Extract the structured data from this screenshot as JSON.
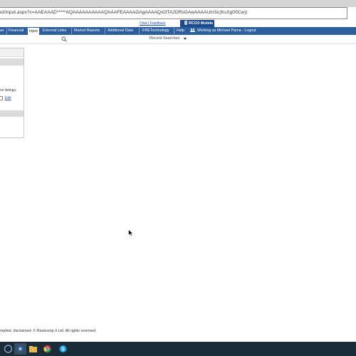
{
  "browser": {
    "address": {
      "visible_text": "ut/Input.aspx?c=AAEAAAD*****AQAAAAAAAAAAQAAAFEAAAAGAgAAAAQxOTA2DRsGAwAAAAUmSc(KsXg00Cw))"
    }
  },
  "header": {
    "chat_link": "Chat | Feedback",
    "mobile_label": "RCO3 Mobile"
  },
  "nav": {
    "items": [
      {
        "label": "ax"
      },
      {
        "label": "Financial"
      },
      {
        "label": "Input"
      },
      {
        "label": "External Links"
      },
      {
        "label": "Market Reports"
      },
      {
        "label": "Additional Data"
      },
      {
        "label": "RETechnology"
      },
      {
        "label": "Help"
      }
    ],
    "active": "Input",
    "user_text": "Working as Michael Parna - Logout"
  },
  "search": {
    "recent_label": "Recent Searches"
  },
  "left_panel": {
    "listings_text": "ns listings.",
    "edit_link": "Edit"
  },
  "footer": {
    "text": "mplied, disclaimed. © Realcomp II Ltd. All rights reserved."
  },
  "taskbar": {
    "icons": [
      "start-button-icon",
      "firefox-icon",
      "file-explorer-icon",
      "chrome-icon",
      "skype-icon"
    ]
  }
}
